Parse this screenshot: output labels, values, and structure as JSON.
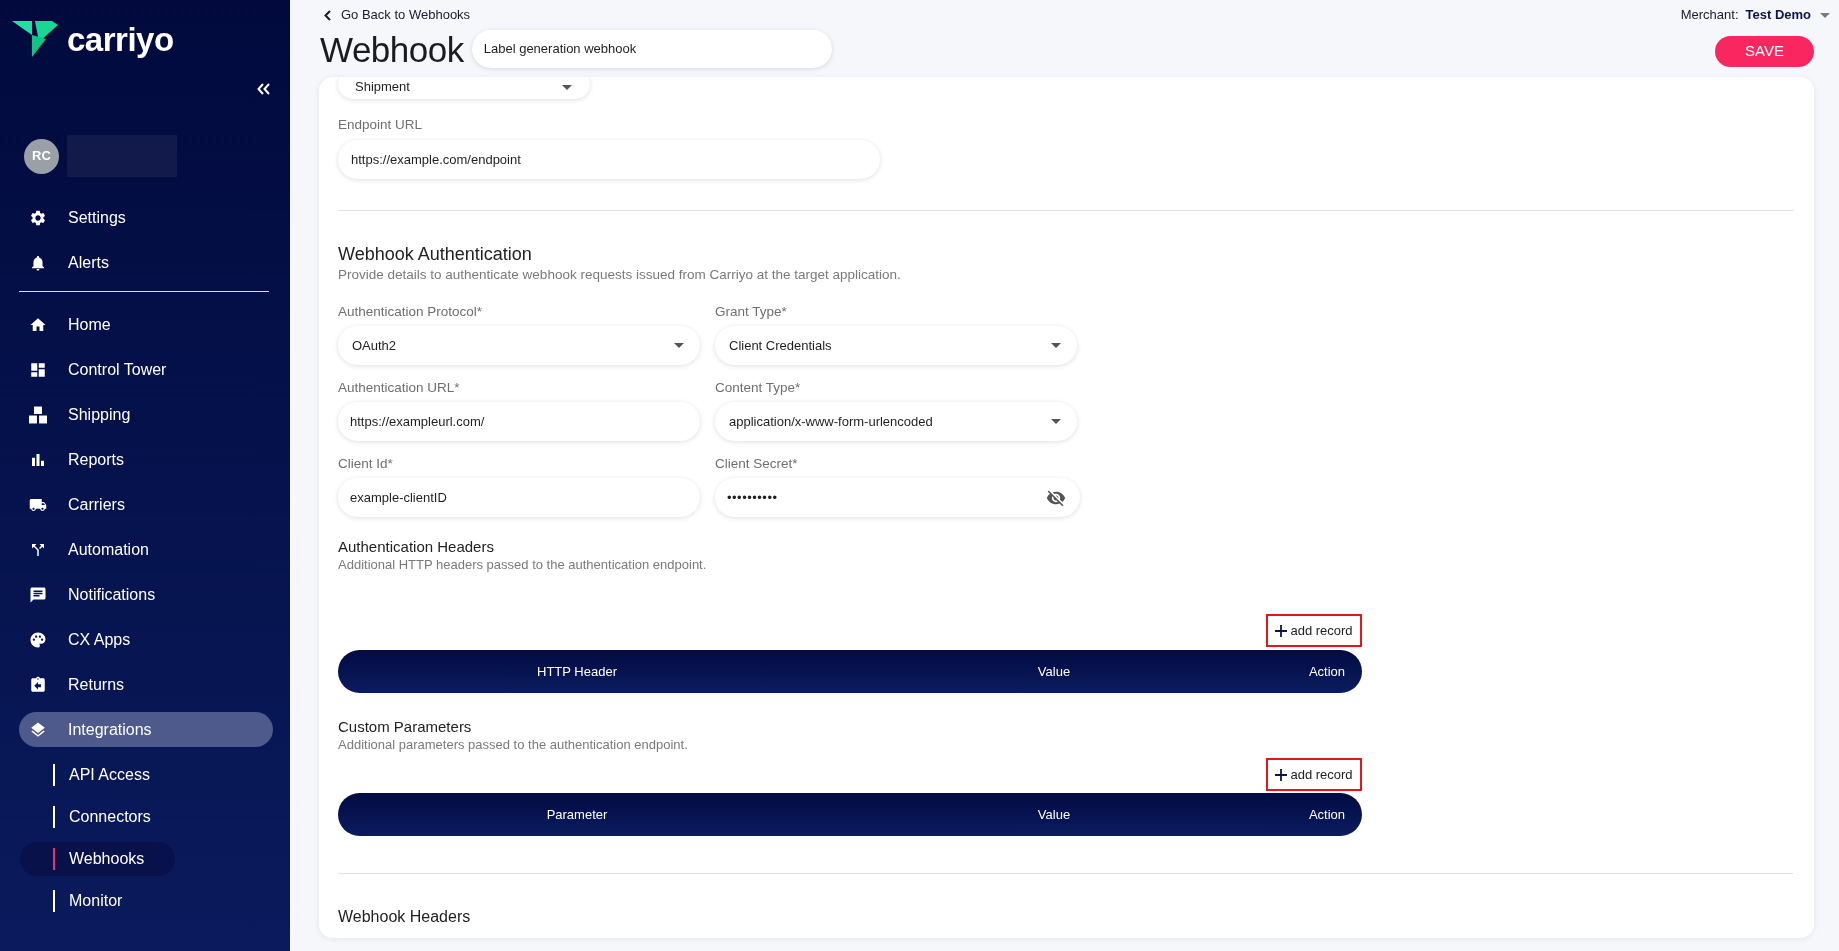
{
  "sidebar": {
    "logo_text": "carriyo",
    "user": {
      "initials": "RC"
    },
    "top_links": [
      {
        "label": "Settings",
        "selected": false
      },
      {
        "label": "Alerts",
        "selected": false
      }
    ],
    "nav": [
      {
        "label": "Home",
        "selected": false
      },
      {
        "label": "Control Tower",
        "selected": false
      },
      {
        "label": "Shipping",
        "selected": false
      },
      {
        "label": "Reports",
        "selected": false
      },
      {
        "label": "Carriers",
        "selected": false
      },
      {
        "label": "Automation",
        "selected": false
      },
      {
        "label": "Notifications",
        "selected": false
      },
      {
        "label": "CX Apps",
        "selected": false
      },
      {
        "label": "Returns",
        "selected": false
      },
      {
        "label": "Integrations",
        "selected": true,
        "children": [
          {
            "label": "API Access",
            "selected": false
          },
          {
            "label": "Connectors",
            "selected": false
          },
          {
            "label": "Webhooks",
            "selected": true
          },
          {
            "label": "Monitor",
            "selected": false
          }
        ]
      }
    ]
  },
  "header": {
    "back_link": "Go Back to Webhooks",
    "title": "Webhook",
    "name_field": {
      "value": "Label generation webhook"
    },
    "merchant": {
      "label": "Merchant:",
      "value": "Test Demo"
    },
    "save_button": "SAVE"
  },
  "form": {
    "event_select": {
      "value": "Shipment"
    },
    "endpoint": {
      "label": "Endpoint URL",
      "value": "https://example.com/endpoint"
    },
    "authentication": {
      "title": "Webhook Authentication",
      "description": "Provide details to authenticate webhook requests issued from Carriyo at the target application.",
      "fields": [
        {
          "label": "Authentication Protocol*",
          "value": "OAuth2",
          "kind": "select"
        },
        {
          "label": "Grant Type*",
          "value": "Client Credentials",
          "kind": "select"
        },
        {
          "label": "Authentication URL*",
          "value": "https://exampleurl.com/",
          "kind": "text"
        },
        {
          "label": "Content Type*",
          "value": "application/x-www-form-urlencoded",
          "kind": "select"
        },
        {
          "label": "Client Id*",
          "value": "example-clientID",
          "kind": "text"
        },
        {
          "label": "Client Secret*",
          "value": "••••••••••",
          "kind": "password"
        }
      ]
    },
    "record_tables": [
      {
        "title": "Authentication Headers",
        "description": "Additional HTTP headers passed to the authentication endpoint.",
        "add_button": {
          "label": "add record",
          "highlighted": true
        },
        "columns": [
          "HTTP Header",
          "Value",
          "Action"
        ]
      },
      {
        "title": "Custom Parameters",
        "description": "Additional parameters passed to the authentication endpoint.",
        "add_button": {
          "label": "add record",
          "highlighted": true
        },
        "columns": [
          "Parameter",
          "Value",
          "Action"
        ]
      }
    ],
    "webhook_headers": {
      "title": "Webhook Headers"
    }
  }
}
